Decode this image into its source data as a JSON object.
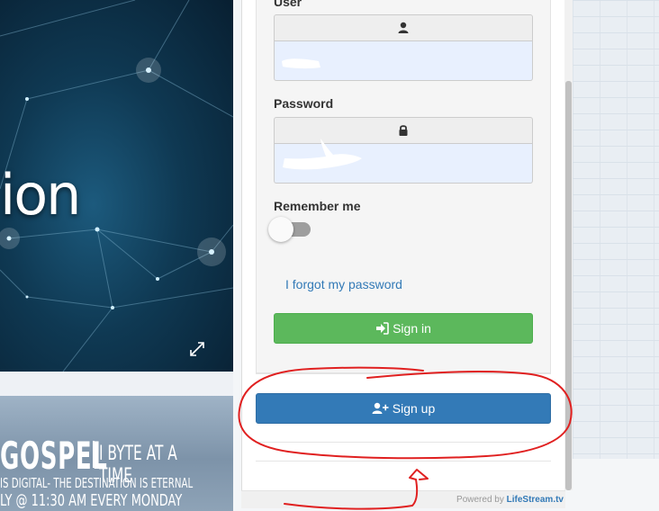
{
  "hero": {
    "text": "ion",
    "icons": {
      "expand": "expand-icon"
    }
  },
  "gospel_banner": {
    "title": "GOSPEL",
    "tagline": "I BYTE AT A TIME",
    "line1": "IS DIGITAL- THE DESTINATION IS ETERNAL",
    "line2": "LY @ 11:30 AM EVERY MONDAY"
  },
  "login_form": {
    "user_label": "User",
    "user_icon": "user-icon",
    "user_value": "",
    "password_label": "Password",
    "password_icon": "lock-icon",
    "password_value": "",
    "remember_label": "Remember me",
    "remember_checked": false,
    "forgot_link": "I forgot my password",
    "signin_label": "Sign in",
    "signin_icon": "sign-in-icon",
    "signup_label": "Sign up",
    "signup_icon": "user-plus-icon"
  },
  "footer": {
    "powered_prefix": "Powered by ",
    "powered_brand": "LifeStream.tv"
  },
  "colors": {
    "signin_green": "#5cb85c",
    "signup_blue": "#337ab7",
    "link_blue": "#337ab7",
    "annotation_red": "#e02020",
    "input_autofill": "#e8f0fe"
  }
}
